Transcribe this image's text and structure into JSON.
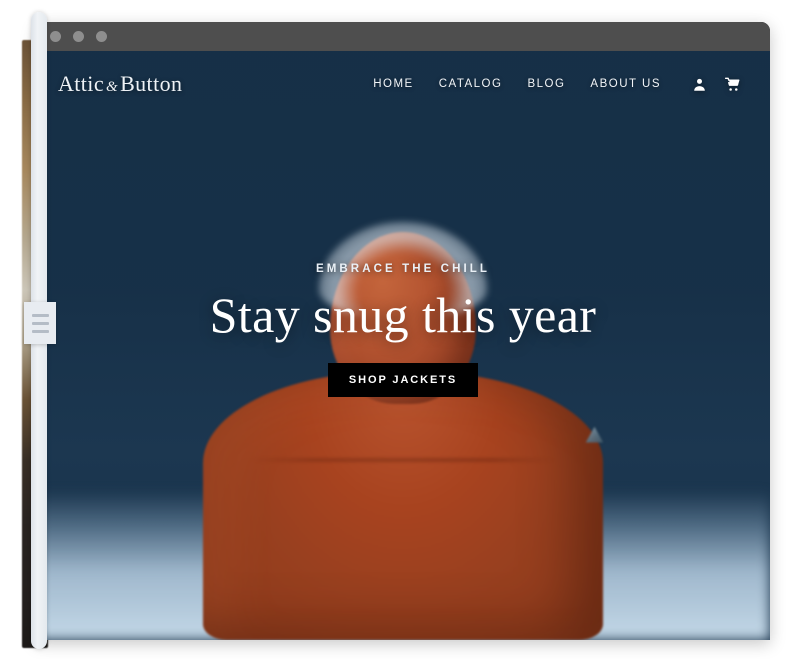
{
  "window": {
    "titlebar": {
      "dots": [
        "close-dot",
        "minimize-dot",
        "maximize-dot"
      ],
      "color": "#4e4e4e"
    }
  },
  "site": {
    "logo": {
      "name": "Attic",
      "ampersand": "&",
      "surname": "Button"
    },
    "nav": {
      "links": [
        {
          "label": "HOME",
          "name": "home"
        },
        {
          "label": "CATALOG",
          "name": "catalog"
        },
        {
          "label": "BLOG",
          "name": "blog"
        },
        {
          "label": "ABOUT US",
          "name": "about-us"
        }
      ],
      "icons": [
        {
          "name": "account-icon",
          "glyph": "person"
        },
        {
          "name": "cart-icon",
          "glyph": "shopping-cart"
        }
      ]
    },
    "hero": {
      "eyebrow": "EMBRACE THE CHILL",
      "headline": "Stay snug this year",
      "cta_label": "SHOP JACKETS",
      "cta_background": "#000000",
      "cta_text_color": "#ffffff",
      "jacket_color": "#a8431f",
      "backdrop_color": "#1e3950"
    }
  },
  "overlay": {
    "drag_handle": {
      "name": "image-compare-handle",
      "grip_lines": 3
    },
    "divider_color": "#e4e9ee"
  }
}
